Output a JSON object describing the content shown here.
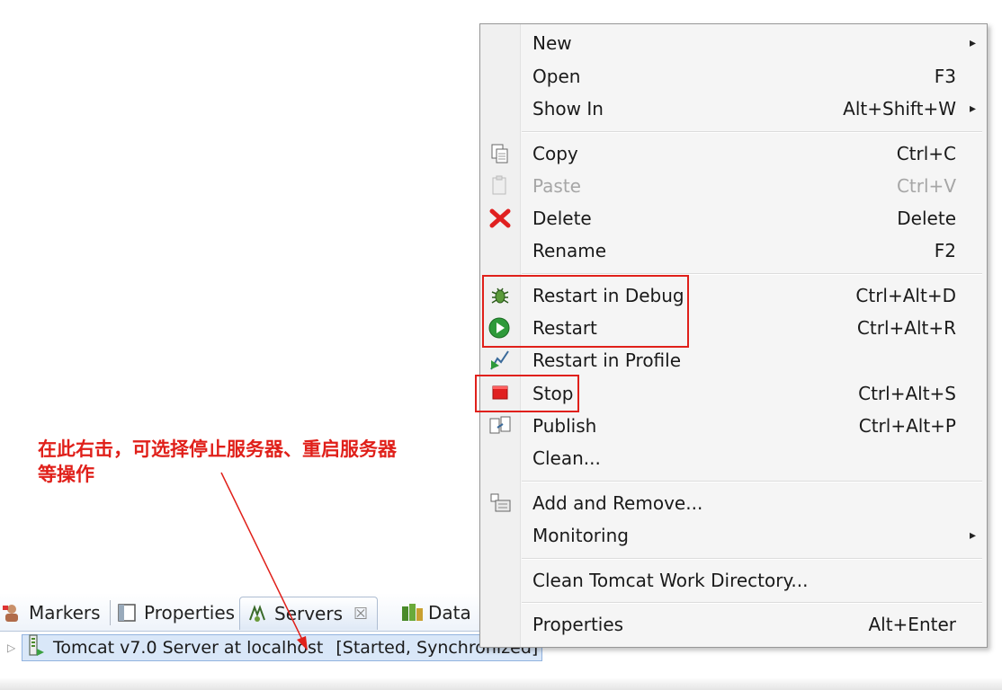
{
  "menu": {
    "items": [
      {
        "label": "New",
        "shortcut": "",
        "submenu": "▸",
        "icon": "none"
      },
      {
        "label": "Open",
        "shortcut": "F3",
        "icon": "none"
      },
      {
        "label": "Show In",
        "shortcut": "Alt+Shift+W",
        "submenu": "▸",
        "icon": "none"
      },
      {
        "label": "Copy",
        "shortcut": "Ctrl+C",
        "icon": "copy-icon"
      },
      {
        "label": "Paste",
        "shortcut": "Ctrl+V",
        "icon": "paste-icon",
        "disabled": true
      },
      {
        "label": "Delete",
        "shortcut": "Delete",
        "icon": "delete-icon"
      },
      {
        "label": "Rename",
        "shortcut": "F2",
        "icon": "none"
      },
      {
        "label": "Restart in Debug",
        "shortcut": "Ctrl+Alt+D",
        "icon": "debug-icon"
      },
      {
        "label": "Restart",
        "shortcut": "Ctrl+Alt+R",
        "icon": "run-icon"
      },
      {
        "label": "Restart in Profile",
        "shortcut": "",
        "icon": "profile-icon"
      },
      {
        "label": "Stop",
        "shortcut": "Ctrl+Alt+S",
        "icon": "stop-icon"
      },
      {
        "label": "Publish",
        "shortcut": "Ctrl+Alt+P",
        "icon": "publish-icon"
      },
      {
        "label": "Clean...",
        "shortcut": "",
        "icon": "none"
      },
      {
        "label": "Add and Remove...",
        "shortcut": "",
        "icon": "add-remove-icon"
      },
      {
        "label": "Monitoring",
        "shortcut": "",
        "submenu": "▸",
        "icon": "none"
      },
      {
        "label": "Clean Tomcat Work Directory...",
        "shortcut": "",
        "icon": "none"
      },
      {
        "label": "Properties",
        "shortcut": "Alt+Enter",
        "icon": "none"
      }
    ]
  },
  "tabs": [
    {
      "label": "Markers",
      "icon": "markers-icon"
    },
    {
      "label": "Properties",
      "icon": "properties-icon"
    },
    {
      "label": "Servers",
      "icon": "servers-icon",
      "active": true,
      "close": "☒"
    },
    {
      "label": "Data",
      "icon": "data-icon"
    }
  ],
  "server_row": {
    "expander": "▷",
    "name": "Tomcat v7.0 Server at localhost",
    "status": "[Started, Synchronized]"
  },
  "annotation": {
    "line1": "在此右击，可选择停止服务器、重启服务器",
    "line2": "等操作"
  },
  "colors": {
    "annotation": "#e0201a",
    "selection": "#d9e7f8"
  }
}
